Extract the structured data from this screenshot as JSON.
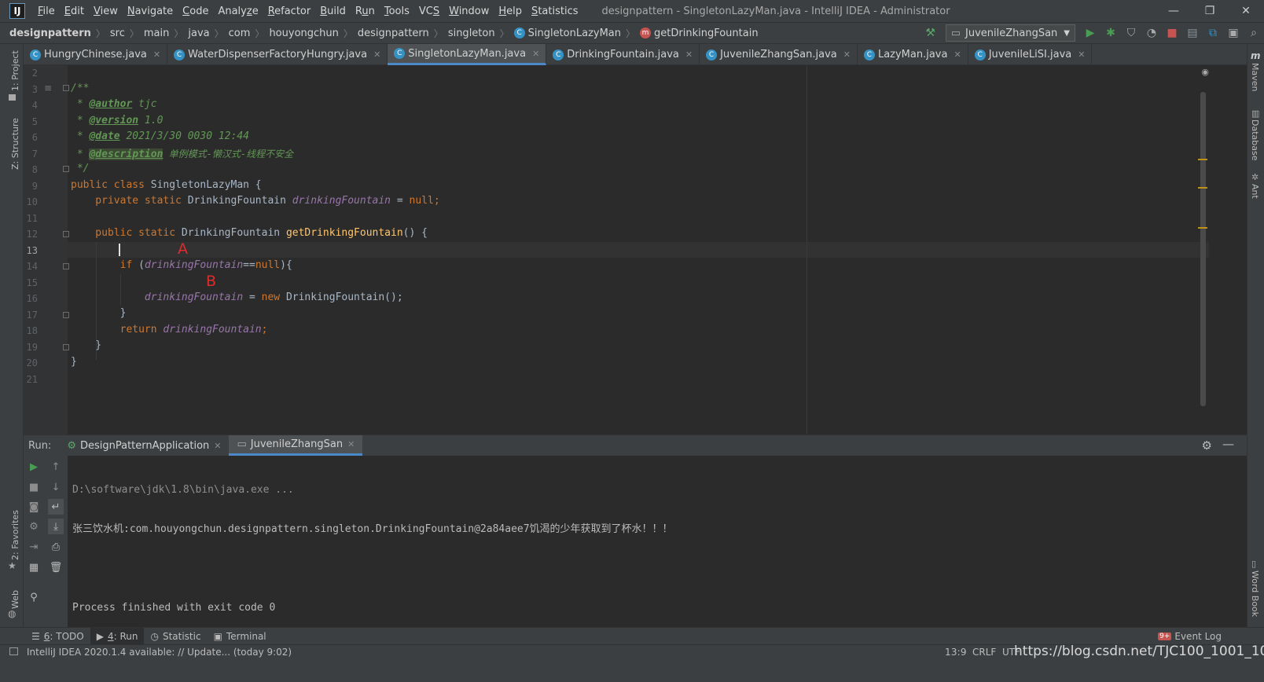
{
  "app": {
    "logo": "IJ",
    "window_title": "designpattern - SingletonLazyMan.java - IntelliJ IDEA - Administrator",
    "menu": [
      {
        "pre": "",
        "u": "F",
        "post": "ile"
      },
      {
        "pre": "",
        "u": "E",
        "post": "dit"
      },
      {
        "pre": "",
        "u": "V",
        "post": "iew"
      },
      {
        "pre": "",
        "u": "N",
        "post": "avigate"
      },
      {
        "pre": "",
        "u": "C",
        "post": "ode"
      },
      {
        "pre": "Analy",
        "u": "z",
        "post": "e"
      },
      {
        "pre": "",
        "u": "R",
        "post": "efactor"
      },
      {
        "pre": "",
        "u": "B",
        "post": "uild"
      },
      {
        "pre": "R",
        "u": "u",
        "post": "n"
      },
      {
        "pre": "",
        "u": "T",
        "post": "ools"
      },
      {
        "pre": "VC",
        "u": "S",
        "post": ""
      },
      {
        "pre": "",
        "u": "W",
        "post": "indow"
      },
      {
        "pre": "",
        "u": "H",
        "post": "elp"
      },
      {
        "pre": "",
        "u": "S",
        "post": "tatistics"
      }
    ],
    "window_buttons": [
      "—",
      "❐",
      "✕"
    ]
  },
  "breadcrumb": {
    "project": "designpattern",
    "items": [
      "src",
      "main",
      "java",
      "com",
      "houyongchun",
      "designpattern",
      "singleton"
    ],
    "class": "SingletonLazyMan",
    "method": "getDrinkingFountain"
  },
  "run_config": {
    "name": "JuvenileZhangSan"
  },
  "editor_tabs": [
    {
      "label": "HungryChinese.java",
      "active": false
    },
    {
      "label": "WaterDispenserFactoryHungry.java",
      "active": false
    },
    {
      "label": "SingletonLazyMan.java",
      "active": true
    },
    {
      "label": "DrinkingFountain.java",
      "active": false
    },
    {
      "label": "JuvenileZhangSan.java",
      "active": false
    },
    {
      "label": "LazyMan.java",
      "active": false
    },
    {
      "label": "JuvenileLiSI.java",
      "active": false
    }
  ],
  "line_numbers": [
    "2",
    "3",
    "4",
    "5",
    "6",
    "7",
    "8",
    "9",
    "10",
    "11",
    "12",
    "13",
    "14",
    "15",
    "16",
    "17",
    "18",
    "19",
    "20",
    "21"
  ],
  "current_line": "13",
  "code": {
    "l3": "/**",
    "l4_pre": " * ",
    "l4_tag": "@author",
    "l4_val": " tjc",
    "l5_pre": " * ",
    "l5_tag": "@version",
    "l5_val": " 1.0",
    "l6_pre": " * ",
    "l6_tag": "@date",
    "l6_val": " 2021/3/30 0030 12:44",
    "l7_pre": " * ",
    "l7_tag": "@description",
    "l7_val": " 单例模式-懒汉式-线程不安全",
    "l8": " */",
    "l9_kw": "public class ",
    "l9_name": "SingletonLazyMan",
    "l9_rest": " {",
    "l10_kw": "    private static ",
    "l10_type": "DrinkingFountain ",
    "l10_fld": "drinkingFountain",
    "l10_rest": " = ",
    "l10_null": "null",
    "l10_end": ";",
    "l12_kw": "    public static ",
    "l12_type": "DrinkingFountain ",
    "l12_meth": "getDrinkingFountain",
    "l12_rest": "() {",
    "l14_kw": "        if",
    "l14_p": " (",
    "l14_fld": "drinkingFountain",
    "l14_eq": "==",
    "l14_null": "null",
    "l14_end": "){",
    "l16_fld": "            drinkingFountain",
    "l16_eq": " = ",
    "l16_new": "new ",
    "l16_rest": "DrinkingFountain();",
    "l17": "        }",
    "l18_kw": "        return ",
    "l18_fld": "drinkingFountain",
    "l18_end": ";",
    "l19": "    }",
    "l20": "}"
  },
  "annotations": {
    "a": "A",
    "b": "B"
  },
  "run_panel": {
    "label": "Run:",
    "tabs": [
      {
        "label": "DesignPatternApplication",
        "active": false
      },
      {
        "label": "JuvenileZhangSan",
        "active": true
      }
    ],
    "console": [
      "D:\\software\\jdk\\1.8\\bin\\java.exe ...",
      "张三饮水机:com.houyongchun.designpattern.singleton.DrinkingFountain@2a84aee7饥渴的少年获取到了杯水！！！",
      "",
      "Process finished with exit code 0"
    ]
  },
  "left_strip": {
    "project": "1: Project",
    "structure": "Z: Structure",
    "favorites": "2: Favorites",
    "web": "Web"
  },
  "right_strip": {
    "maven": "Maven",
    "database": "Database",
    "ant": "Ant",
    "wordbook": "Word Book"
  },
  "bottom_tools": [
    {
      "pre": "",
      "u": "6",
      "post": ": TODO",
      "active": false
    },
    {
      "pre": "",
      "u": "4",
      "post": ": Run",
      "active": true
    },
    {
      "pre": "",
      "u": "",
      "post": "Statistic",
      "active": false
    },
    {
      "pre": "",
      "u": "",
      "post": "Terminal",
      "active": false
    }
  ],
  "event_log": {
    "badge": "9+",
    "label": "Event Log"
  },
  "status": {
    "message": "IntelliJ IDEA 2020.1.4 available: // Update... (today 9:02)",
    "position": "13:9",
    "line_sep": "CRLF",
    "encoding": "UTF",
    "watermark": "https://blog.csdn.net/TJC100_1001_10"
  },
  "colors": {
    "keyword": "#cc7832",
    "field": "#9876aa",
    "method": "#ffc66d",
    "comment": "#629755",
    "accent": "#4a88c7",
    "annotation": "#e02b2b"
  }
}
